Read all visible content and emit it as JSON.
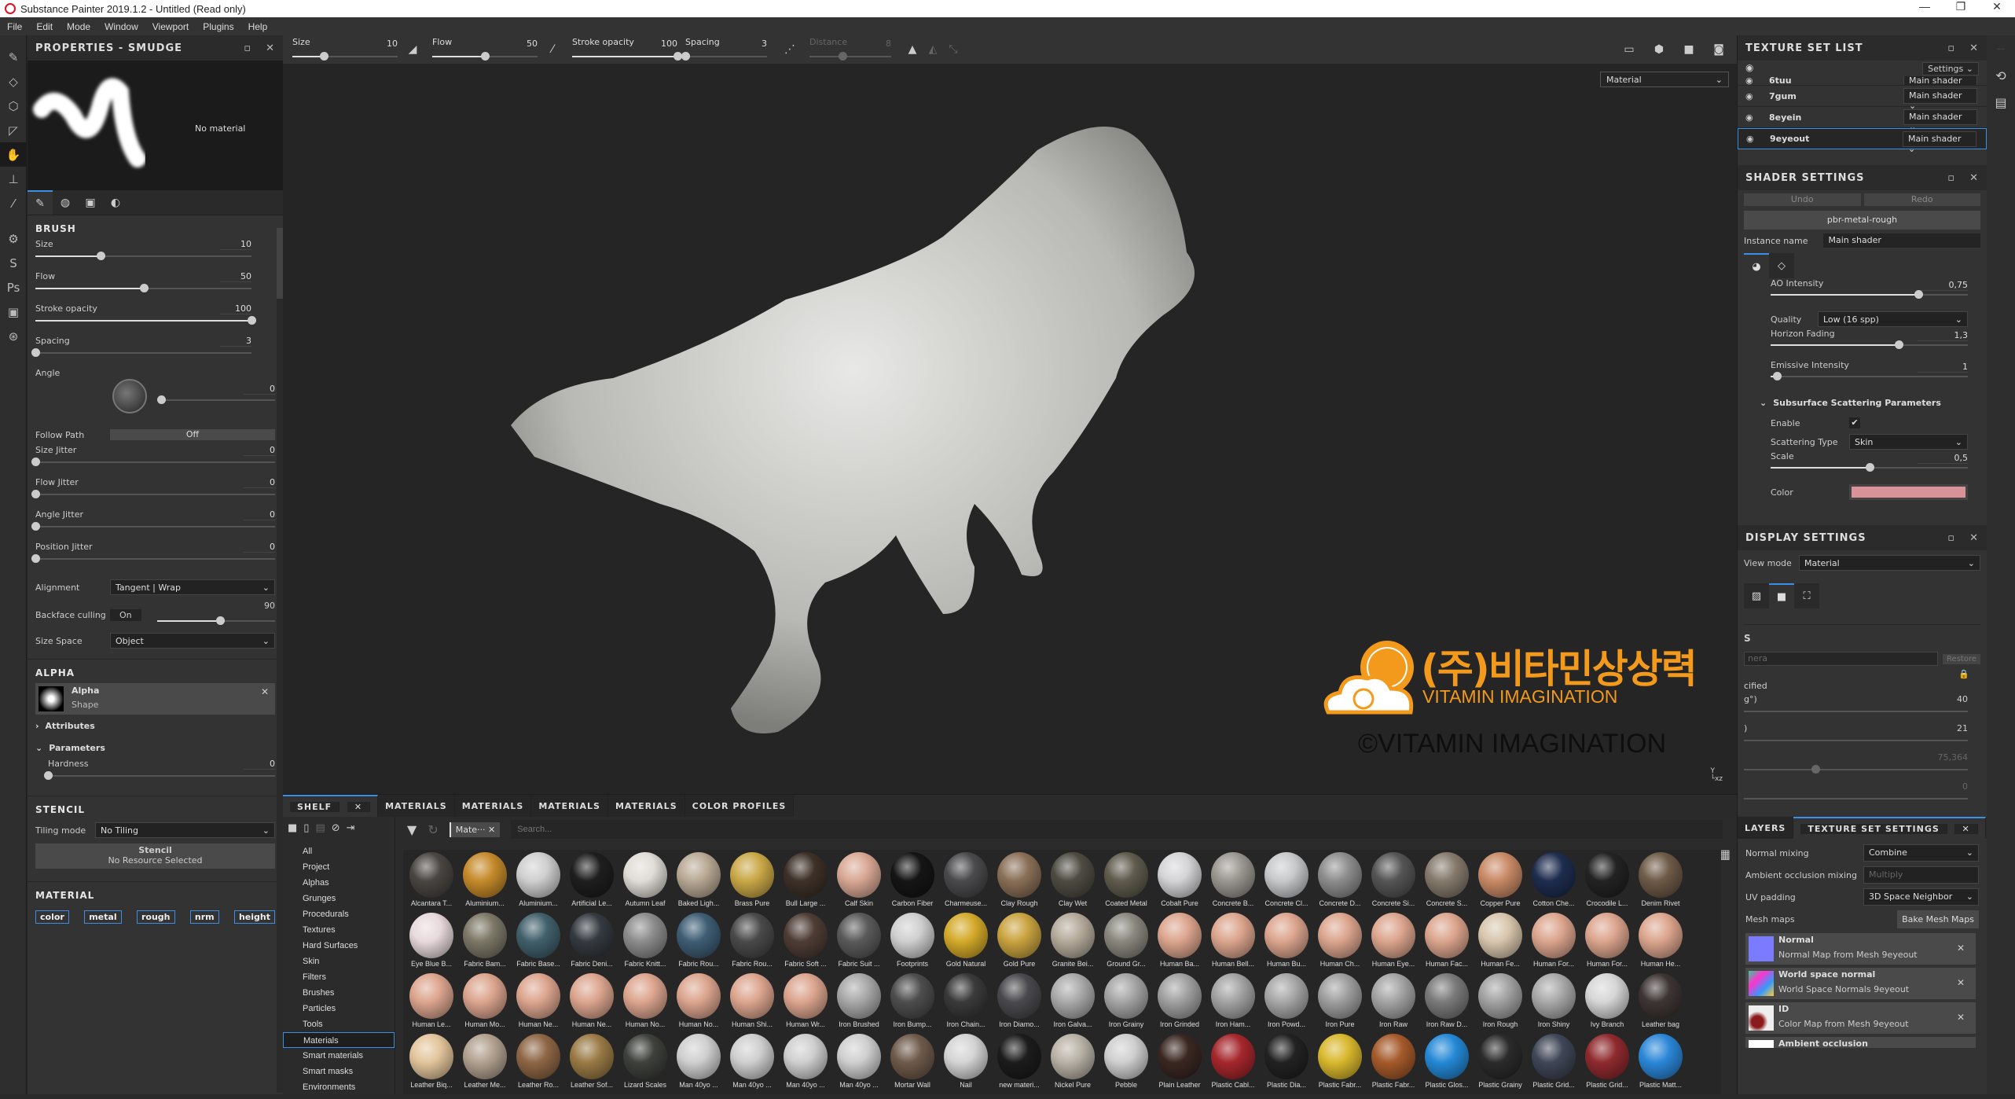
{
  "window": {
    "title": "Substance Painter 2019.1.2 - Untitled (Read only)",
    "controls": [
      "—",
      "❐",
      "✕"
    ]
  },
  "menu": [
    "File",
    "Edit",
    "Mode",
    "Window",
    "Viewport",
    "Plugins",
    "Help"
  ],
  "left_tools": [
    {
      "name": "paint-brush-icon",
      "glyph": "✎"
    },
    {
      "name": "eraser-icon",
      "glyph": "◇"
    },
    {
      "name": "projection-icon",
      "glyph": "⬡"
    },
    {
      "name": "polygon-fill-icon",
      "glyph": "◸"
    },
    {
      "name": "smudge-icon",
      "glyph": "✋"
    },
    {
      "name": "clone-stamp-icon",
      "glyph": "⊥"
    },
    {
      "name": "color-picker-icon",
      "glyph": "⁄"
    },
    {
      "name": "substance-share-icon",
      "glyph": "⚙"
    },
    {
      "name": "substance-source-icon",
      "glyph": "S"
    },
    {
      "name": "photoshop-icon",
      "glyph": "Ps"
    },
    {
      "name": "export-icon",
      "glyph": "▣"
    },
    {
      "name": "substance-icon",
      "glyph": "⊛"
    }
  ],
  "properties": {
    "title": "PROPERTIES - SMUDGE",
    "no_material": "No material",
    "brush": {
      "heading": "BRUSH",
      "size": {
        "label": "Size",
        "value": "10",
        "fraction": 0.3
      },
      "flow": {
        "label": "Flow",
        "value": "50",
        "fraction": 0.5
      },
      "stroke_opacity": {
        "label": "Stroke opacity",
        "value": "100",
        "fraction": 1.0
      },
      "spacing": {
        "label": "Spacing",
        "value": "3",
        "fraction": 0.0
      },
      "angle": {
        "label": "Angle",
        "value": "0",
        "fraction": 0.0
      },
      "follow_path": {
        "label": "Follow Path",
        "value": "Off"
      },
      "size_jitter": {
        "label": "Size Jitter",
        "value": "0",
        "fraction": 0.0
      },
      "flow_jitter": {
        "label": "Flow Jitter",
        "value": "0",
        "fraction": 0.0
      },
      "angle_jitter": {
        "label": "Angle Jitter",
        "value": "0",
        "fraction": 0.0
      },
      "position_jitter": {
        "label": "Position Jitter",
        "value": "0",
        "fraction": 0.0
      },
      "alignment": {
        "label": "Alignment",
        "value": "Tangent | Wrap"
      },
      "backface_culling": {
        "label": "Backface culling",
        "toggle": "On",
        "value": "90",
        "fraction": 0.5
      },
      "size_space": {
        "label": "Size Space",
        "value": "Object"
      }
    },
    "alpha": {
      "heading": "ALPHA",
      "name": "Alpha",
      "shape": "Shape",
      "attributes": "Attributes",
      "parameters": "Parameters",
      "hardness": {
        "label": "Hardness",
        "value": "0",
        "fraction": 0.0
      }
    },
    "stencil": {
      "heading": "STENCIL",
      "tiling_label": "Tiling mode",
      "tiling_value": "No Tiling",
      "title": "Stencil",
      "resource": "No Resource Selected"
    },
    "material": {
      "heading": "MATERIAL",
      "channels": [
        "color",
        "metal",
        "rough",
        "nrm",
        "height"
      ]
    }
  },
  "toolbar": {
    "size": {
      "label": "Size",
      "value": "10",
      "fraction": 0.3
    },
    "flow": {
      "label": "Flow",
      "value": "50",
      "fraction": 0.5
    },
    "stroke_opacity": {
      "label": "Stroke opacity",
      "value": "100",
      "fraction": 1.0
    },
    "spacing": {
      "label": "Spacing",
      "value": "3",
      "fraction": 0.0
    },
    "distance": {
      "label": "Distance",
      "value": "8",
      "fraction": 0.4
    },
    "view_mode": "Material"
  },
  "watermark": {
    "korean": "(주)비타민상상력",
    "english": "VITAMIN IMAGINATION",
    "copyright": "©VITAMIN IMAGINATION"
  },
  "texture_set_list": {
    "title": "TEXTURE SET LIST",
    "settings": "Settings",
    "items": [
      {
        "name": "6tuu",
        "shader": "Main shader"
      },
      {
        "name": "7gum",
        "shader": "Main shader"
      },
      {
        "name": "8eyein",
        "shader": "Main shader"
      },
      {
        "name": "9eyeout",
        "shader": "Main shader",
        "selected": true
      }
    ]
  },
  "shader_settings": {
    "title": "SHADER SETTINGS",
    "undo": "Undo",
    "redo": "Redo",
    "shader": "pbr-metal-rough",
    "instance_label": "Instance name",
    "instance_value": "Main shader",
    "ao_intensity": {
      "label": "AO Intensity",
      "value": "0,75",
      "fraction": 0.75
    },
    "quality": {
      "label": "Quality",
      "value": "Low (16 spp)"
    },
    "horizon_fading": {
      "label": "Horizon Fading",
      "value": "1,3",
      "fraction": 0.65
    },
    "emissive_intensity": {
      "label": "Emissive Intensity",
      "value": "1",
      "fraction": 0.03
    },
    "sss_heading": "Subsurface Scattering Parameters",
    "enable": {
      "label": "Enable",
      "checked": true
    },
    "scattering_type": {
      "label": "Scattering Type",
      "value": "Skin"
    },
    "scale": {
      "label": "Scale",
      "value": "0,5",
      "fraction": 0.5
    },
    "color": {
      "label": "Color",
      "hex": "#d99398"
    }
  },
  "display_settings": {
    "title": "DISPLAY SETTINGS",
    "view_mode_label": "View mode",
    "view_mode_value": "Material",
    "camera_heading": "S",
    "camera_field": "nera",
    "restore": "Restore",
    "specified": "cified",
    "fov_label": "g°)",
    "fov_value": "40",
    "focal_label": ")",
    "focal_value": "21",
    "focus_value": "75,364",
    "aperture_value": "0"
  },
  "texture_set_settings": {
    "tabs": [
      "LAYERS",
      "TEXTURE SET SETTINGS"
    ],
    "normal_mixing": {
      "label": "Normal mixing",
      "value": "Combine"
    },
    "ao_mixing": {
      "label": "Ambient occlusion mixing",
      "value": "Multiply"
    },
    "uv_padding": {
      "label": "UV padding",
      "value": "3D Space Neighbor"
    },
    "mesh_maps_label": "Mesh maps",
    "bake_button": "Bake Mesh Maps",
    "mesh_maps": [
      {
        "title": "Normal",
        "source": "Normal Map from Mesh 9eyeout"
      },
      {
        "title": "World space normal",
        "source": "World Space Normals 9eyeout"
      },
      {
        "title": "ID",
        "source": "Color Map from Mesh 9eyeout"
      },
      {
        "title": "Ambient occlusion",
        "source": ""
      }
    ]
  },
  "shelf": {
    "tabs": [
      "SHELF",
      "MATERIALS",
      "MATERIALS",
      "MATERIALS",
      "MATERIALS",
      "COLOR PROFILES"
    ],
    "filter_chip": "Mate···",
    "search_placeholder": "Search...",
    "categories": [
      "All",
      "Project",
      "Alphas",
      "Grunges",
      "Procedurals",
      "Textures",
      "Hard Surfaces",
      "Skin",
      "Filters",
      "Brushes",
      "Particles",
      "Tools",
      "Materials",
      "Smart materials",
      "Smart masks",
      "Environments"
    ],
    "selected_category": "Materials",
    "materials": [
      [
        "Alcantara T...",
        "#4a4642"
      ],
      [
        "Aluminium...",
        "#c58a2a"
      ],
      [
        "Aluminium...",
        "#cfcfcf"
      ],
      [
        "Artificial Le...",
        "#1e1e1e"
      ],
      [
        "Autumn Leaf",
        "#e0dcd6"
      ],
      [
        "Baked Ligh...",
        "#b9a995"
      ],
      [
        "Brass Pure",
        "#c9a847"
      ],
      [
        "Bull Large ...",
        "#3e3128"
      ],
      [
        "Calf Skin",
        "#d9a894"
      ],
      [
        "Carbon Fiber",
        "#151515"
      ],
      [
        "Charmeuse...",
        "#4a4a4c"
      ],
      [
        "Clay Rough",
        "#8a6f57"
      ],
      [
        "Clay Wet",
        "#4e4c42"
      ],
      [
        "Coated Metal",
        "#5f5b4d"
      ],
      [
        "Cobalt Pure",
        "#d4d4d6"
      ],
      [
        "Concrete B...",
        "#9a9690"
      ],
      [
        "Concrete Cl...",
        "#c7c9cb"
      ],
      [
        "Concrete D...",
        "#8d8d8d"
      ],
      [
        "Concrete Si...",
        "#555555"
      ],
      [
        "Concrete S...",
        "#857a6c"
      ],
      [
        "Copper Pure",
        "#c98a66"
      ],
      [
        "Cotton Che...",
        "#1e2d4f"
      ],
      [
        "Crocodile L...",
        "#232323"
      ],
      [
        "Denim Rivet",
        "#6e5a47"
      ],
      [
        "Eye Blue B...",
        "#e8d9dc"
      ],
      [
        "Fabric Bam...",
        "#7c7766"
      ],
      [
        "Fabric Base...",
        "#41606b"
      ],
      [
        "Fabric Deni...",
        "#343a40"
      ],
      [
        "Fabric Knitt...",
        "#8c8c8c"
      ],
      [
        "Fabric Rou...",
        "#3e5d74"
      ],
      [
        "Fabric Rou...",
        "#4a4a4a"
      ],
      [
        "Fabric Soft ...",
        "#4e3d35"
      ],
      [
        "Fabric Suit ...",
        "#5a5a5a"
      ],
      [
        "Footprints",
        "#cfcfcf"
      ],
      [
        "Gold Natural",
        "#d4aa2a"
      ],
      [
        "Gold Pure",
        "#c9a33f"
      ],
      [
        "Granite Bei...",
        "#b4aa9a"
      ],
      [
        "Ground Gr...",
        "#8a877e"
      ],
      [
        "Human Ba...",
        "#dca58e"
      ],
      [
        "Human Bell...",
        "#dca58e"
      ],
      [
        "Human Bu...",
        "#dca58e"
      ],
      [
        "Human Ch...",
        "#dca58e"
      ],
      [
        "Human Eye...",
        "#dca58e"
      ],
      [
        "Human Fac...",
        "#dca58e"
      ],
      [
        "Human Fe...",
        "#d8c6ad"
      ],
      [
        "Human For...",
        "#dca58e"
      ],
      [
        "Human For...",
        "#dca58e"
      ],
      [
        "Human He...",
        "#dca58e"
      ],
      [
        "Human Le...",
        "#dca58e"
      ],
      [
        "Human Mo...",
        "#dca58e"
      ],
      [
        "Human Ne...",
        "#dca58e"
      ],
      [
        "Human Ne...",
        "#dca58e"
      ],
      [
        "Human No...",
        "#dca58e"
      ],
      [
        "Human No...",
        "#dca58e"
      ],
      [
        "Human Shi...",
        "#dca58e"
      ],
      [
        "Human Wr...",
        "#dca58e"
      ],
      [
        "Iron Brushed",
        "#a8a8a8"
      ],
      [
        "Iron Bump...",
        "#4d4d4d"
      ],
      [
        "Iron Chain...",
        "#3a3a3a"
      ],
      [
        "Iron Diamo...",
        "#4a4a4e"
      ],
      [
        "Iron Galva...",
        "#aaaaaa"
      ],
      [
        "Iron Grainy",
        "#a5a5a5"
      ],
      [
        "Iron Grinded",
        "#a0a0a0"
      ],
      [
        "Iron Ham...",
        "#a3a3a3"
      ],
      [
        "Iron Powd...",
        "#a7a7a7"
      ],
      [
        "Iron Pure",
        "#9e9e9e"
      ],
      [
        "Iron Raw",
        "#a4a4a4"
      ],
      [
        "Iron Raw D...",
        "#7a7a7a"
      ],
      [
        "Iron Rough",
        "#a2a2a2"
      ],
      [
        "Iron Shiny",
        "#a9a9a9"
      ],
      [
        "Ivy Branch",
        "#d6d6d6"
      ],
      [
        "Leather bag",
        "#3d3533"
      ],
      [
        "Leather Biq...",
        "#e3c59c"
      ],
      [
        "Leather Me...",
        "#b2a18f"
      ],
      [
        "Leather Ro...",
        "#8e6645"
      ],
      [
        "Leather Sof...",
        "#9a7a45"
      ],
      [
        "Lizard Scales",
        "#3e413c"
      ],
      [
        "Man 40yo ...",
        "#cfcfcf"
      ],
      [
        "Man 40yo ...",
        "#cfcfcf"
      ],
      [
        "Man 40yo ...",
        "#cfcfcf"
      ],
      [
        "Man 40yo ...",
        "#cfcfcf"
      ],
      [
        "Mortar Wall",
        "#6e5a4a"
      ],
      [
        "Nail",
        "#d4d4d4"
      ],
      [
        "new materi...",
        "#1c1c1c"
      ],
      [
        "Nickel Pure",
        "#b8b2a6"
      ],
      [
        "Pebble",
        "#cfcfcf"
      ],
      [
        "Plain Leather",
        "#3a2722"
      ],
      [
        "Plastic Cabl...",
        "#a5272c"
      ],
      [
        "Plastic Dia...",
        "#222222"
      ],
      [
        "Plastic Fabr...",
        "#d9b82d"
      ],
      [
        "Plastic Fabr...",
        "#a55a2a"
      ],
      [
        "Plastic Glos...",
        "#2489d6"
      ],
      [
        "Plastic Grainy",
        "#2b2b2b"
      ],
      [
        "Plastic Grid...",
        "#3f4656"
      ],
      [
        "Plastic Grid...",
        "#8f2a2e"
      ],
      [
        "Plastic Matt...",
        "#2b87d8"
      ]
    ]
  }
}
